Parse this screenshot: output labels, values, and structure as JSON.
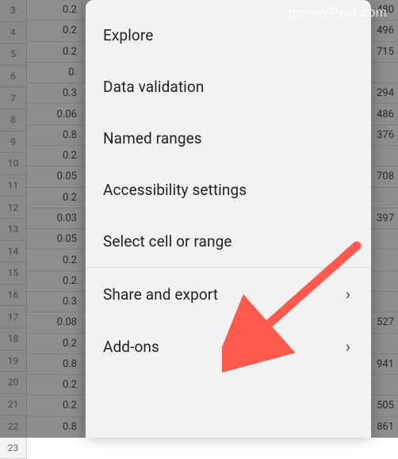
{
  "watermark": "groovyPost.com",
  "menu": {
    "items": [
      {
        "label": "Explore",
        "has_chevron": false
      },
      {
        "label": "Data validation",
        "has_chevron": false
      },
      {
        "label": "Named ranges",
        "has_chevron": false
      },
      {
        "label": "Accessibility settings",
        "has_chevron": false
      },
      {
        "label": "Select cell or range",
        "has_chevron": false
      }
    ],
    "sectioned_items": [
      {
        "label": "Share and export",
        "has_chevron": true
      },
      {
        "label": "Add-ons",
        "has_chevron": true
      }
    ]
  },
  "sheet": {
    "row_start": 3,
    "row_end": 23,
    "rows": [
      {
        "n": "3",
        "a": "0.2",
        "b": "480"
      },
      {
        "n": "4",
        "a": "0.2",
        "b": "496"
      },
      {
        "n": "5",
        "a": "0.2",
        "b": "715"
      },
      {
        "n": "6",
        "a": "0.",
        "b": ""
      },
      {
        "n": "7",
        "a": "0.3",
        "b": "294"
      },
      {
        "n": "8",
        "a": "0.06",
        "b": "486"
      },
      {
        "n": "9",
        "a": "0.8",
        "b": "376"
      },
      {
        "n": "10",
        "a": "0.2",
        "b": ""
      },
      {
        "n": "11",
        "a": "0.05",
        "b": "708"
      },
      {
        "n": "12",
        "a": "0.2",
        "b": ""
      },
      {
        "n": "13",
        "a": "0.03",
        "b": "397"
      },
      {
        "n": "14",
        "a": "0.05",
        "b": ""
      },
      {
        "n": "15",
        "a": "0.2",
        "b": ""
      },
      {
        "n": "16",
        "a": "0.2",
        "b": ""
      },
      {
        "n": "17",
        "a": "0.3",
        "b": ""
      },
      {
        "n": "18",
        "a": "0.08",
        "b": "527"
      },
      {
        "n": "19",
        "a": "0.2",
        "b": ""
      },
      {
        "n": "20",
        "a": "0.8",
        "b": "941"
      },
      {
        "n": "21",
        "a": "0.2",
        "b": ""
      },
      {
        "n": "22",
        "a": "0.2",
        "b": "505"
      },
      {
        "n": "23",
        "a": "0.8",
        "b": "861"
      }
    ]
  }
}
